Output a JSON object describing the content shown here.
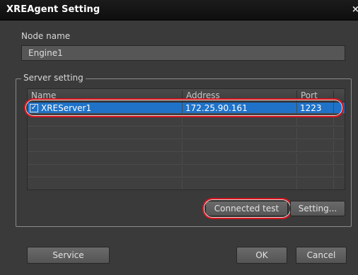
{
  "window": {
    "title": "XREAgent Setting",
    "close_icon": "×"
  },
  "node": {
    "label": "Node name",
    "value": "Engine1"
  },
  "server_setting": {
    "legend": "Server setting",
    "columns": [
      "Name",
      "Address",
      "Port"
    ],
    "rows": [
      {
        "checked": true,
        "name": "XREServer1",
        "address": "172.25.90.161",
        "port": "1223",
        "selected": true
      }
    ],
    "empty_rows": 6,
    "buttons": {
      "connected_test": "Connected test",
      "setting": "Setting..."
    }
  },
  "footer": {
    "service": "Service",
    "ok": "OK",
    "cancel": "Cancel"
  },
  "colors": {
    "selection": "#1f72c8",
    "highlight": "#d2141e"
  }
}
